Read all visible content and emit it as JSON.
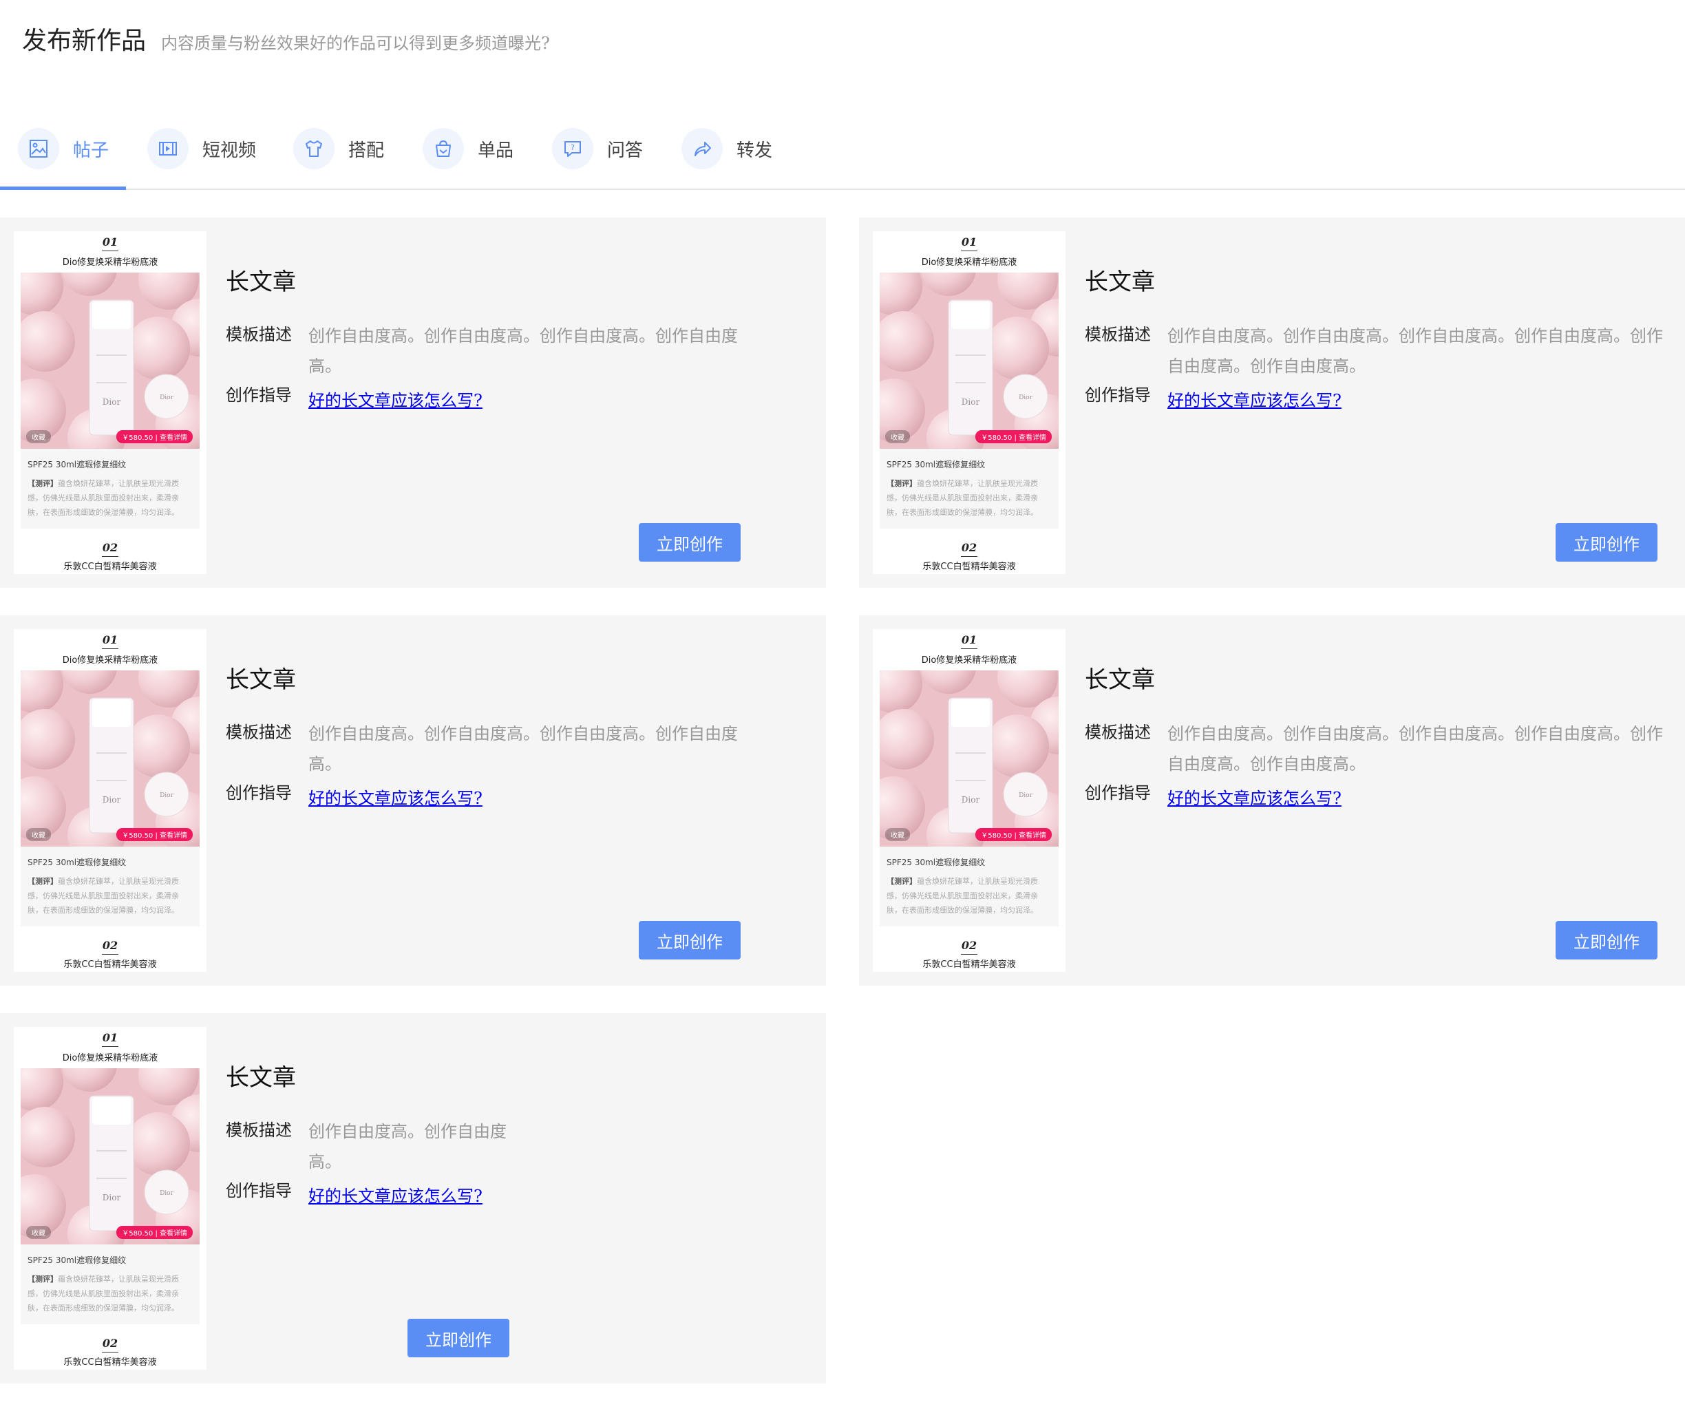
{
  "header": {
    "title": "发布新作品",
    "subtitle": "内容质量与粉丝效果好的作品可以得到更多频道曝光?"
  },
  "tabs": [
    {
      "label": "帖子",
      "icon": "image-post-icon",
      "active": true
    },
    {
      "label": "短视频",
      "icon": "video-icon",
      "active": false
    },
    {
      "label": "搭配",
      "icon": "tshirt-icon",
      "active": false
    },
    {
      "label": "单品",
      "icon": "shopping-bag-icon",
      "active": false
    },
    {
      "label": "问答",
      "icon": "question-chat-icon",
      "active": false
    },
    {
      "label": "转发",
      "icon": "share-arrow-icon",
      "active": false
    }
  ],
  "thumbnail": {
    "num1": "01",
    "product1": "Dio修复焕采精华粉底液",
    "favorite": "收藏",
    "price_tag": "￥580.50 | 查看详情",
    "spec": "SPF25 30ml遮瑕修复细纹",
    "review_tag": "【测评】",
    "review_text": "蕴含焕妍花臻萃，让肌肤呈现光滑质感，仿佛光线是从肌肤里面投射出来，柔滑亲肤，在表面形成细致的保湿薄膜，均匀润泽。",
    "num2": "02",
    "product2": "乐敦CC白皙精华美容液"
  },
  "cards": [
    {
      "title": "长文章",
      "desc_label": "模板描述",
      "desc_lines": [
        "创作自由度高。创作自由度高。创作自由度高。创作自由度",
        "高。"
      ],
      "guide_label": "创作指导",
      "guide_link": "好的长文章应该怎么写? ",
      "button": "立即创作"
    },
    {
      "title": "长文章",
      "desc_label": "模板描述",
      "desc_lines": [
        "创作自由度高。创作自由度高。创作自由度高。创作自由度高。创作",
        "自由度高。创作自由度高。"
      ],
      "guide_label": "创作指导",
      "guide_link": "好的长文章应该怎么写? ",
      "button": "立即创作"
    },
    {
      "title": "长文章",
      "desc_label": "模板描述",
      "desc_lines": [
        "创作自由度高。创作自由度高。创作自由度高。创作自由度",
        "高。"
      ],
      "guide_label": "创作指导",
      "guide_link": "好的长文章应该怎么写? ",
      "button": "立即创作"
    },
    {
      "title": "长文章",
      "desc_label": "模板描述",
      "desc_lines": [
        "创作自由度高。创作自由度高。创作自由度高。创作自由度高。创作",
        "自由度高。创作自由度高。"
      ],
      "guide_label": "创作指导",
      "guide_link": "好的长文章应该怎么写? ",
      "button": "立即创作"
    },
    {
      "title": "长文章",
      "desc_label": "模板描述",
      "desc_lines": [
        "创作自由度高。创作自由度",
        "高。"
      ],
      "guide_label": "创作指导",
      "guide_link": "好的长文章应该怎么写? ",
      "button": "立即创作"
    }
  ],
  "colors": {
    "accent": "#5b8ef5",
    "card_bg": "#f5f5f5",
    "tab_icon_bg": "#eff4fd",
    "price_tag": "#f0185e",
    "link": "#0000ee"
  }
}
